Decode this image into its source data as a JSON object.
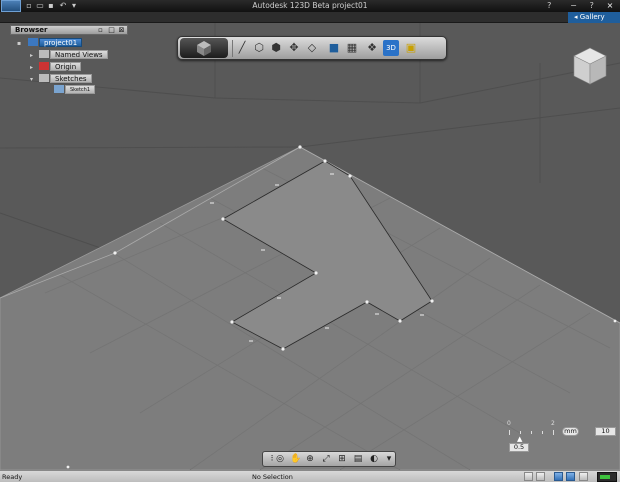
{
  "window": {
    "title": "Autodesk 123D Beta   project01",
    "controls": [
      "−",
      "?",
      "×"
    ]
  },
  "ribbon": {
    "gallery_label": "Gallery"
  },
  "browser": {
    "title": "Browser",
    "project": "project01",
    "items": [
      "Named Views",
      "Origin",
      "Sketches"
    ],
    "sketch_item": "Sketch1"
  },
  "toolbar": {
    "icons": [
      "line-icon",
      "box-icon",
      "extrude-icon",
      "move-icon",
      "sweep-icon",
      "shell-icon",
      "pattern-icon",
      "group-icon",
      "3d-snap-icon",
      "measure-icon"
    ],
    "snap_label": "3D"
  },
  "grid_control": {
    "ruler_left": "0",
    "ruler_mid": "2",
    "unit": "mm",
    "size_value": "10",
    "step_value": "0.5"
  },
  "status": {
    "left": "Ready",
    "selection": "No Selection"
  },
  "colors": {
    "accent": "#1f5e9c",
    "grid_plane": "#7d7d7d",
    "sketch_fill": "#8a8a8a"
  }
}
